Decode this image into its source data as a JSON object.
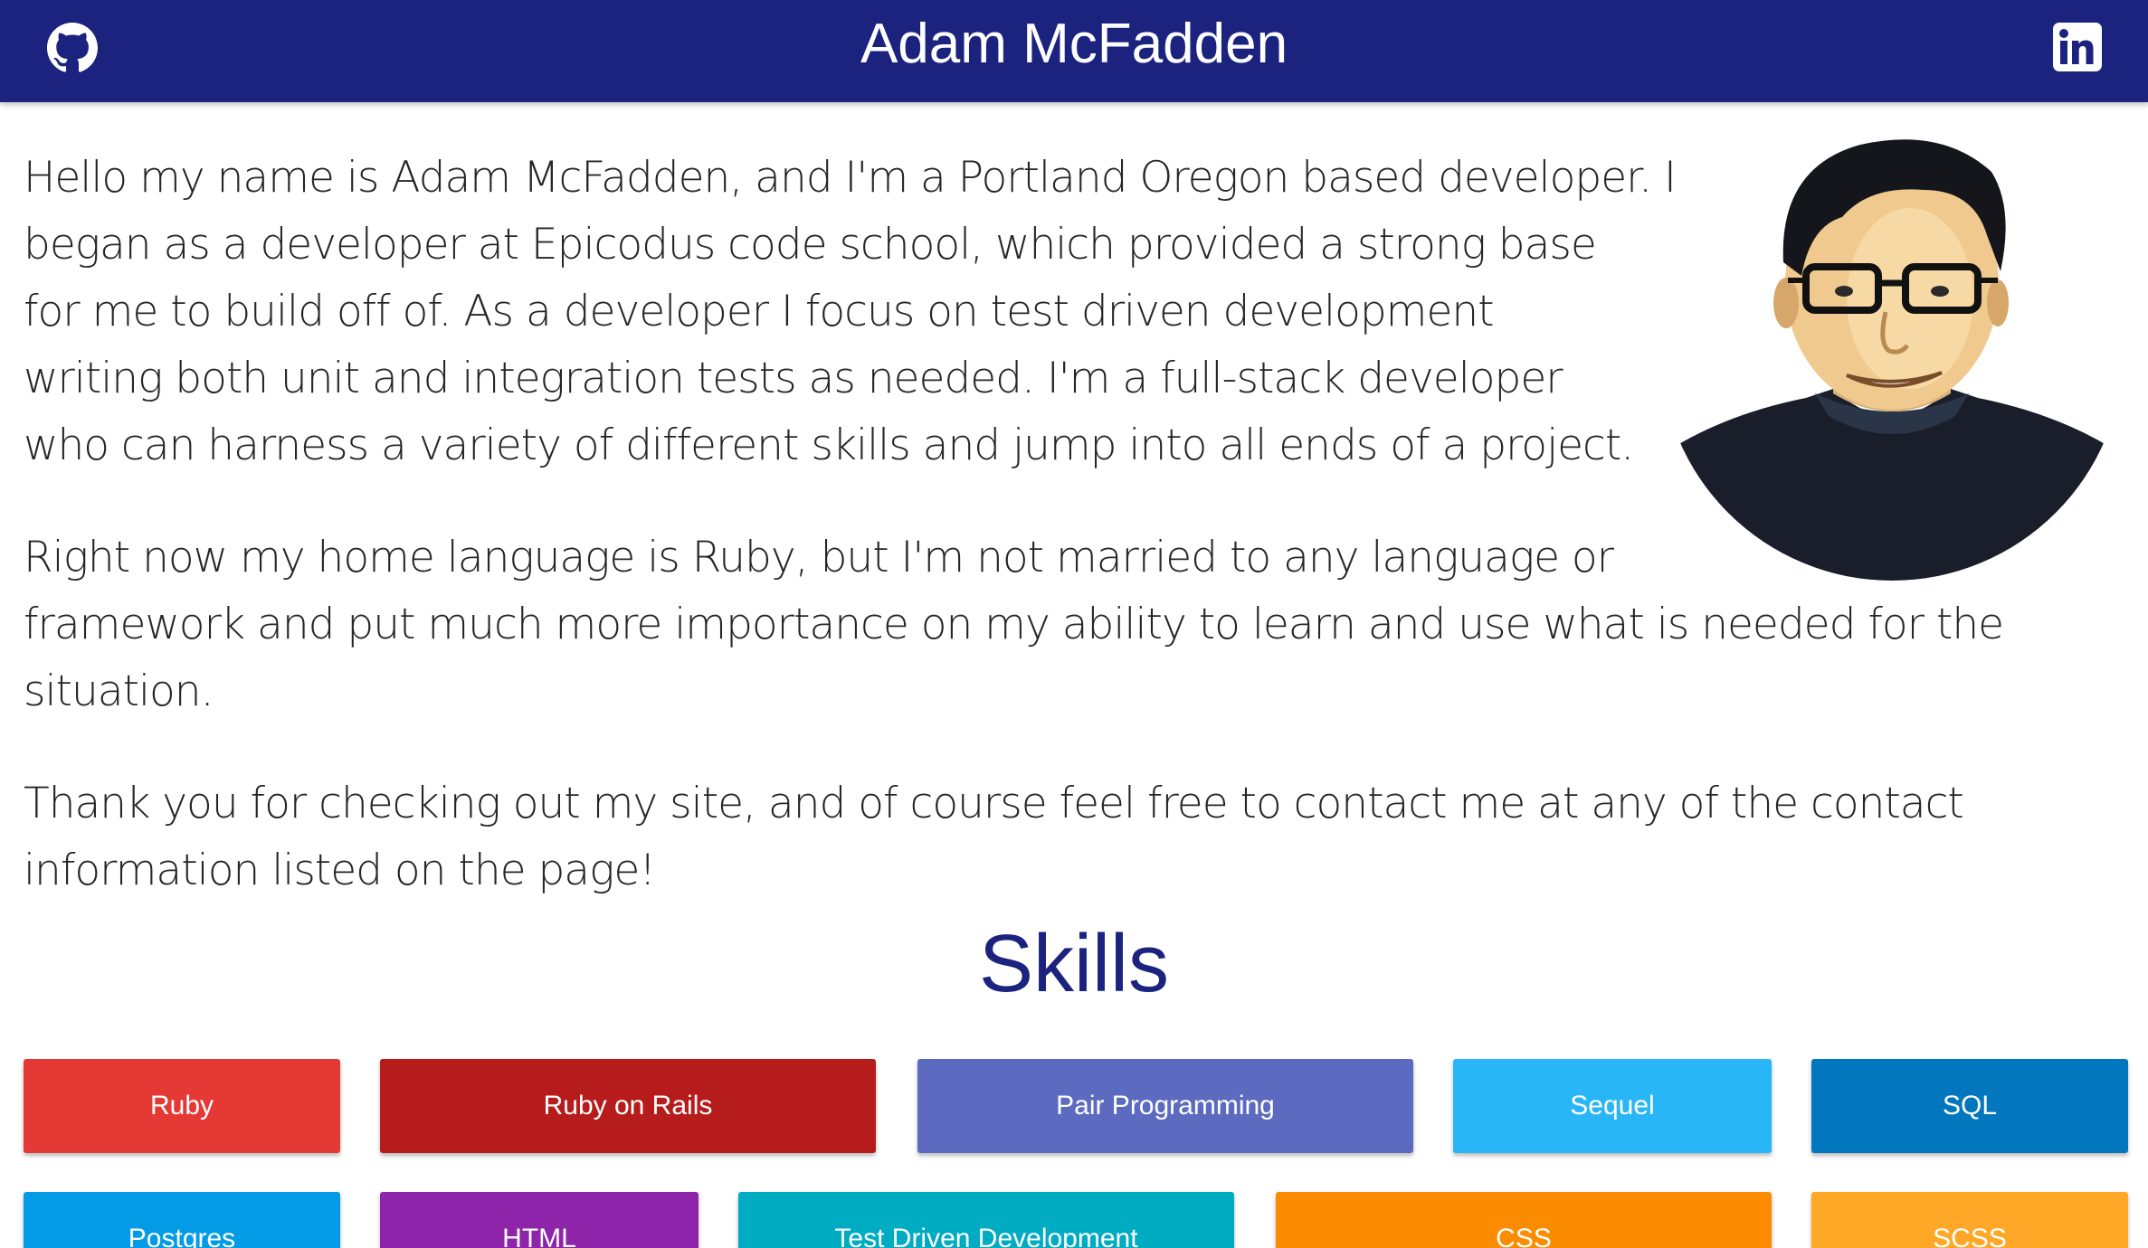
{
  "header": {
    "title": "Adam McFadden",
    "left_icon": "github-icon",
    "right_icon": "linkedin-icon",
    "background": "#1b237f"
  },
  "bio": {
    "paragraphs": [
      "Hello my name is Adam McFadden, and I'm a Portland Oregon based developer. I began as a developer at Epicodus code school, which provided a strong base for me to build off of. As a developer I focus on test driven development writing both unit and integration tests as needed. I'm a full-stack developer who can harness a variety of different skills and jump into all ends of a project.",
      "Right now my home language is Ruby, but I'm not married to any language or framework and put much more importance on my ability to learn and use what is needed for the situation.",
      "Thank you for checking out my site, and of course feel free to contact me at any of the contact information listed on the page!"
    ]
  },
  "skills": {
    "title": "Skills",
    "items": [
      {
        "label": "Ruby",
        "color": "#e53935"
      },
      {
        "label": "Ruby on Rails",
        "color": "#b71c1c"
      },
      {
        "label": "Pair Programming",
        "color": "#5c6bc0"
      },
      {
        "label": "Sequel",
        "color": "#29b6f6"
      },
      {
        "label": "SQL",
        "color": "#0277bd"
      },
      {
        "label": "Postgres",
        "color": "#039be5"
      },
      {
        "label": "HTML",
        "color": "#8e24aa"
      },
      {
        "label": "Test Driven Development",
        "color": "#00acc1"
      },
      {
        "label": "CSS",
        "color": "#fb8c00"
      },
      {
        "label": "SCSS",
        "color": "#ffa726"
      }
    ]
  }
}
